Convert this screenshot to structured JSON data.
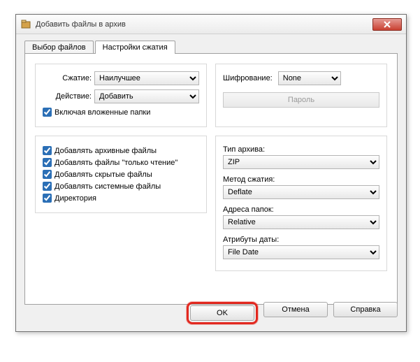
{
  "window": {
    "title": "Добавить файлы в архив"
  },
  "tabs": {
    "files": "Выбор файлов",
    "compression": "Настройки сжатия"
  },
  "compression": {
    "label_compression": "Сжатие:",
    "value_compression": "Наилучшее",
    "label_action": "Действие:",
    "value_action": "Добавить",
    "cb_recurse": "Включая вложенные папки"
  },
  "encryption": {
    "label": "Шифрование:",
    "value": "None",
    "password_btn": "Пароль"
  },
  "addflags": {
    "archive": "Добавлять архивные файлы",
    "readonly": "Добавлять файлы \"только чтение\"",
    "hidden": "Добавлять скрытые файлы",
    "system": "Добавлять системные файлы",
    "directory": "Директория"
  },
  "archive": {
    "label_type": "Тип архива:",
    "value_type": "ZIP",
    "label_method": "Метод сжатия:",
    "value_method": "Deflate",
    "label_folder": "Адреса папок:",
    "value_folder": "Relative",
    "label_date": "Атрибуты даты:",
    "value_date": "File Date"
  },
  "buttons": {
    "ok": "OK",
    "cancel": "Отмена",
    "help": "Справка"
  }
}
